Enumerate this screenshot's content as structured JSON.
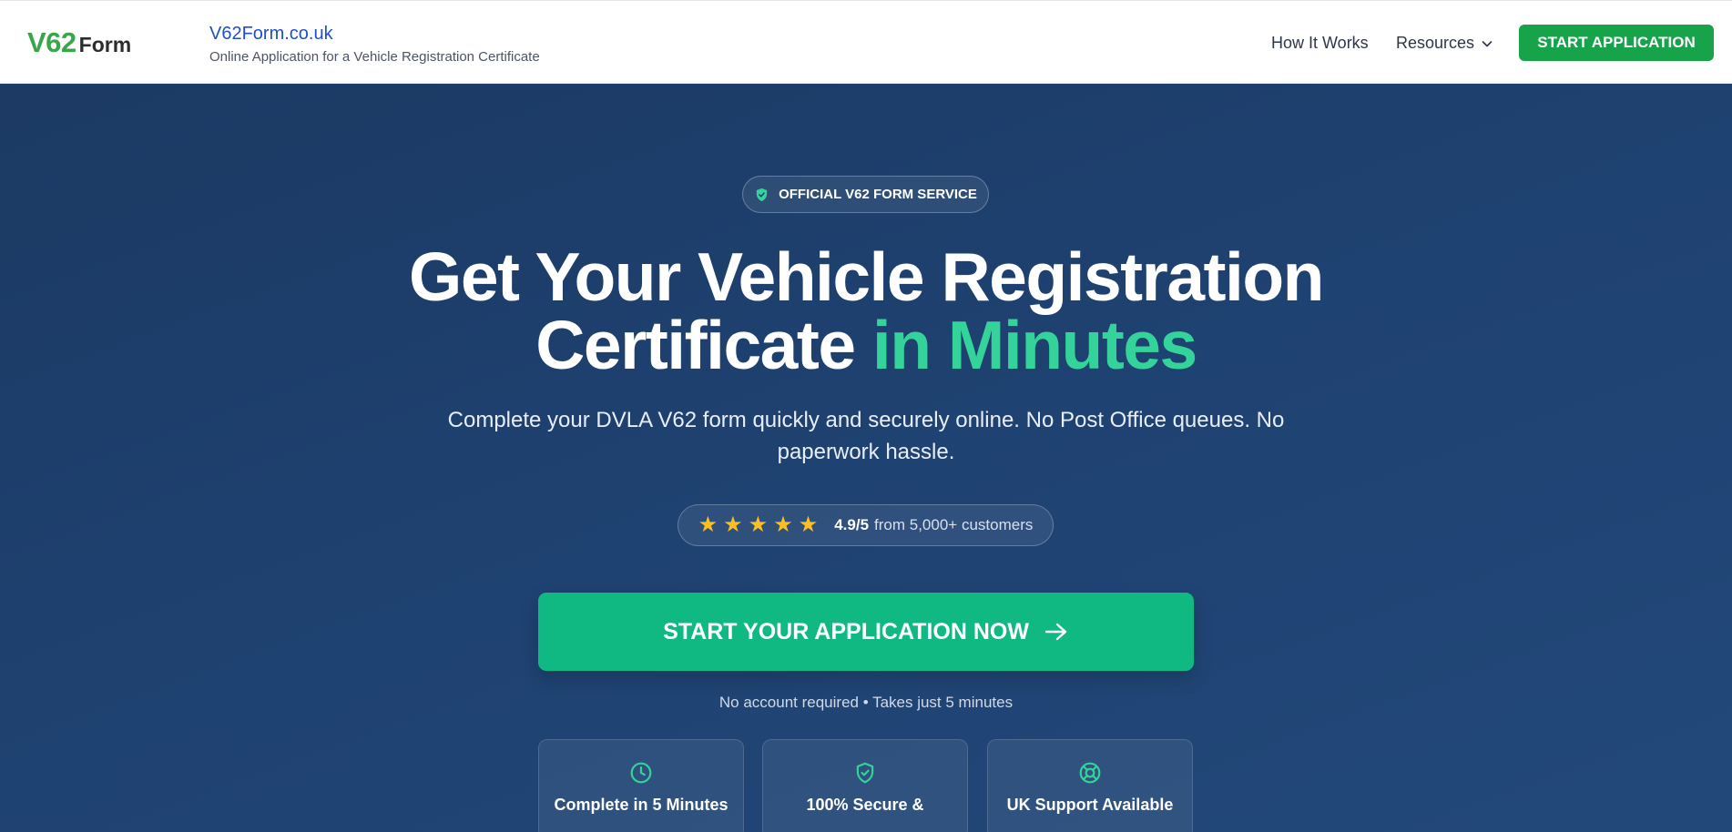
{
  "header": {
    "logo_main": "V62",
    "logo_sub": "Form",
    "site_name": "V62Form.co.uk",
    "tagline": "Online Application for a Vehicle Registration Certificate",
    "nav": {
      "how_it_works": "How It Works",
      "resources": "Resources"
    },
    "cta_label": "START APPLICATION"
  },
  "hero": {
    "badge": "OFFICIAL V62 FORM SERVICE",
    "title_line1": "Get Your Vehicle Registration",
    "title_line2_plain": "Certificate",
    "title_line2_accent": "in Minutes",
    "subtitle": "Complete your DVLA V62 form quickly and securely online. No Post Office queues. No paperwork hassle.",
    "rating": {
      "stars": 5,
      "score": "4.9/5",
      "text": "from 5,000+ customers"
    },
    "cta_label": "START YOUR APPLICATION NOW",
    "cta_note": "No account required • Takes just 5 minutes",
    "features": [
      {
        "label": "Complete in 5 Minutes",
        "icon": "clock-icon"
      },
      {
        "label": "100% Secure &",
        "icon": "shield-check-icon"
      },
      {
        "label": "UK Support Available",
        "icon": "lifebuoy-icon"
      }
    ]
  },
  "colors": {
    "brand_green": "#17a34a",
    "accent_green": "#34d399",
    "cta_green": "#10b981",
    "hero_navy": "#1e4170",
    "link_blue": "#1d4fc9",
    "star_gold": "#fbbf24"
  }
}
